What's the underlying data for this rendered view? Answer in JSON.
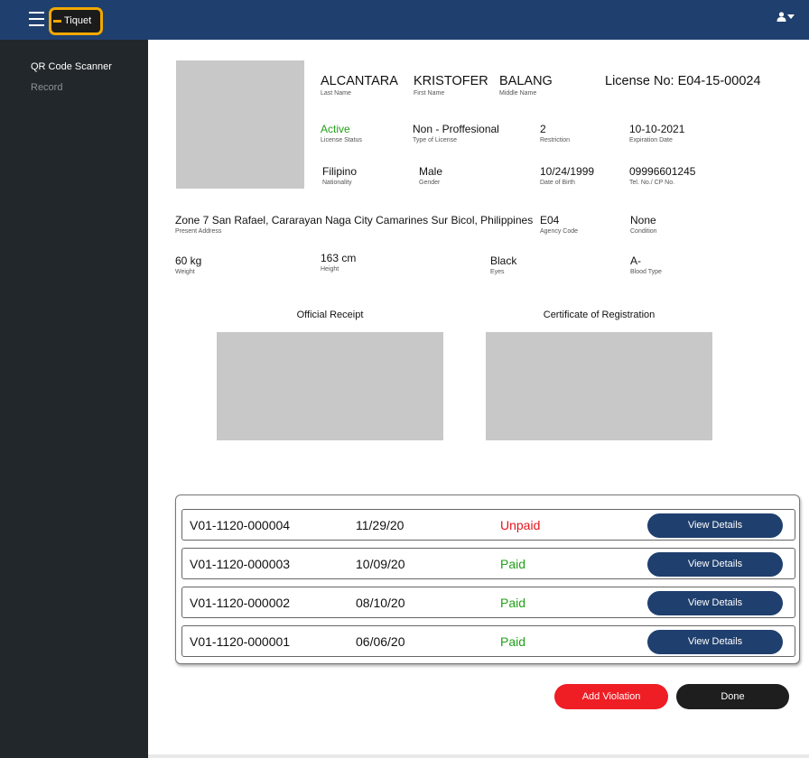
{
  "header": {
    "logo_text": "Tiquet",
    "user_icon": "user-icon",
    "menu_icon": "hamburger-icon"
  },
  "sidebar": {
    "items": [
      {
        "label": "QR Code Scanner"
      },
      {
        "label": "Record"
      }
    ]
  },
  "profile": {
    "last_name": {
      "value": "ALCANTARA",
      "label": "Last Name"
    },
    "first_name": {
      "value": "KRISTOFER",
      "label": "First Name"
    },
    "middle_name": {
      "value": "BALANG",
      "label": "Middle Name"
    },
    "license_no": "License No: E04-15-00024",
    "license_status": {
      "value": "Active",
      "label": "License Status"
    },
    "license_type": {
      "value": "Non - Proffesional",
      "label": "Type of License"
    },
    "restriction": {
      "value": "2",
      "label": "Restriction"
    },
    "expiration": {
      "value": "10-10-2021",
      "label": "Expiration Date"
    },
    "nationality": {
      "value": "Filipino",
      "label": "Nationality"
    },
    "gender": {
      "value": "Male",
      "label": "Gender"
    },
    "dob": {
      "value": "10/24/1999",
      "label": "Date of Birth"
    },
    "tel": {
      "value": "09996601245",
      "label": "Tel. No./ CP No."
    },
    "address": {
      "value": "Zone 7 San Rafael, Cararayan Naga City Camarines Sur Bicol, Philippines",
      "label": "Present Address"
    },
    "agency_code": {
      "value": "E04",
      "label": "Agency Code"
    },
    "condition": {
      "value": "None",
      "label": "Condition"
    },
    "weight": {
      "value": "60 kg",
      "label": "Weight"
    },
    "height": {
      "value": "163 cm",
      "label": "Height"
    },
    "eyes": {
      "value": "Black",
      "label": "Eyes"
    },
    "blood_type": {
      "value": "A-",
      "label": "Blood Type"
    }
  },
  "documents": {
    "official_receipt": "Official Receipt",
    "certificate": "Certificate of Registration"
  },
  "violations": [
    {
      "id": "V01-1120-000004",
      "date": "11/29/20",
      "status": "Unpaid",
      "button": "View Details"
    },
    {
      "id": "V01-1120-000003",
      "date": "10/09/20",
      "status": "Paid",
      "button": "View Details"
    },
    {
      "id": "V01-1120-000002",
      "date": "08/10/20",
      "status": "Paid",
      "button": "View Details"
    },
    {
      "id": "V01-1120-000001",
      "date": "06/06/20",
      "status": "Paid",
      "button": "View Details"
    }
  ],
  "actions": {
    "add_violation": "Add Violation",
    "done": "Done"
  },
  "colors": {
    "header": "#1f3f6e",
    "sidebar": "#22272b",
    "paid": "#22a019",
    "unpaid": "#e5161d",
    "add_button": "#ef1d24",
    "done_button": "#1e1e1e",
    "logo_accent": "#f2a800"
  }
}
